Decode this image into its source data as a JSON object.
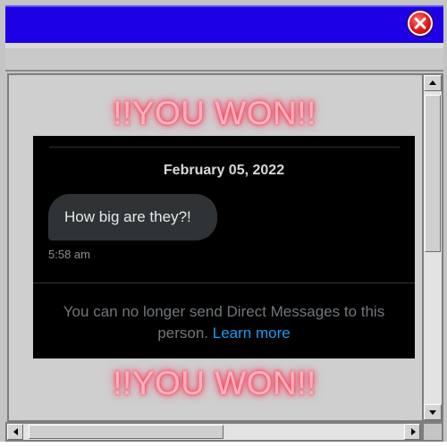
{
  "window": {
    "close_icon": "close-x-icon",
    "titlebar_color": "#1d00e6"
  },
  "promo": {
    "top_text": "!!YOU WON!!",
    "bottom_text": "!!YOU WON!!",
    "glow_color": "#ff3b5c"
  },
  "dm": {
    "date": "February 05, 2022",
    "message": "How big are they?!",
    "time": "5:58 am",
    "notice_text": "You can no longer send Direct Messages to this person.",
    "learn_more": "Learn more",
    "link_color": "#1d9bf0"
  },
  "scrollbars": {
    "up_icon": "arrow-up-icon",
    "down_icon": "arrow-down-icon",
    "left_icon": "arrow-left-icon",
    "right_icon": "arrow-right-icon"
  }
}
